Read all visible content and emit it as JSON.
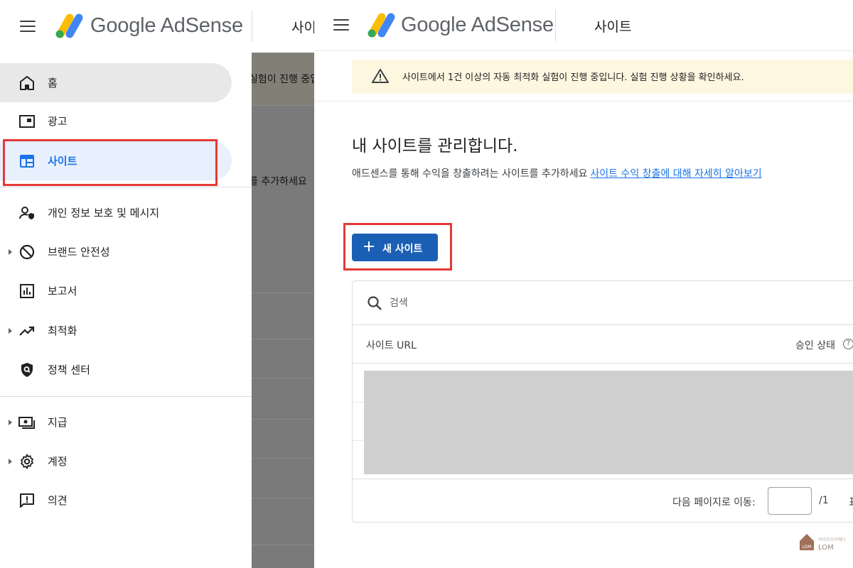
{
  "brand": {
    "name": "Google AdSense",
    "colors": {
      "blue": "#4285f4",
      "yellow": "#fbbc04",
      "green": "#34a853",
      "accent": "#1a73e8",
      "alert": "#e53935"
    }
  },
  "left": {
    "header": {
      "page_label": "사이"
    },
    "behind": {
      "line1": "실험이 진행 중입",
      "line2": "를 추가하세요"
    },
    "nav": [
      {
        "label": "홈",
        "icon": "home-icon"
      },
      {
        "label": "광고",
        "icon": "ads-icon"
      },
      {
        "label": "사이트",
        "icon": "sites-icon"
      },
      {
        "label": "개인 정보 보호 및 메시지",
        "icon": "privacy-icon"
      },
      {
        "label": "브랜드 안전성",
        "icon": "block-icon"
      },
      {
        "label": "보고서",
        "icon": "reports-icon"
      },
      {
        "label": "최적화",
        "icon": "trending-up-icon"
      },
      {
        "label": "정책 센터",
        "icon": "policy-shield-icon"
      },
      {
        "label": "지급",
        "icon": "payments-icon"
      },
      {
        "label": "계정",
        "icon": "gear-icon"
      },
      {
        "label": "의견",
        "icon": "feedback-icon"
      }
    ]
  },
  "right": {
    "header": {
      "page_label": "사이트"
    },
    "notice": {
      "text": "사이트에서 1건 이상의 자동 최적화 실험이 진행 중입니다. 실험 진행 상황을 확인하세요."
    },
    "title": "내 사이트를 관리합니다.",
    "subtitle": "애드센스를 통해 수익을 창출하려는 사이트를 추가하세요",
    "learn_more": "사이트 수익 창출에 대해 자세히 알아보기",
    "new_site_button": "새 사이트",
    "search": {
      "placeholder": "검색"
    },
    "table": {
      "columns": [
        "사이트 URL",
        "승인 상태"
      ]
    },
    "pager": {
      "label": "다음 페이지로 이동:",
      "total": "/1",
      "next": "표"
    }
  },
  "watermark": {
    "text": "LOM",
    "small": "라이프오브매니"
  }
}
